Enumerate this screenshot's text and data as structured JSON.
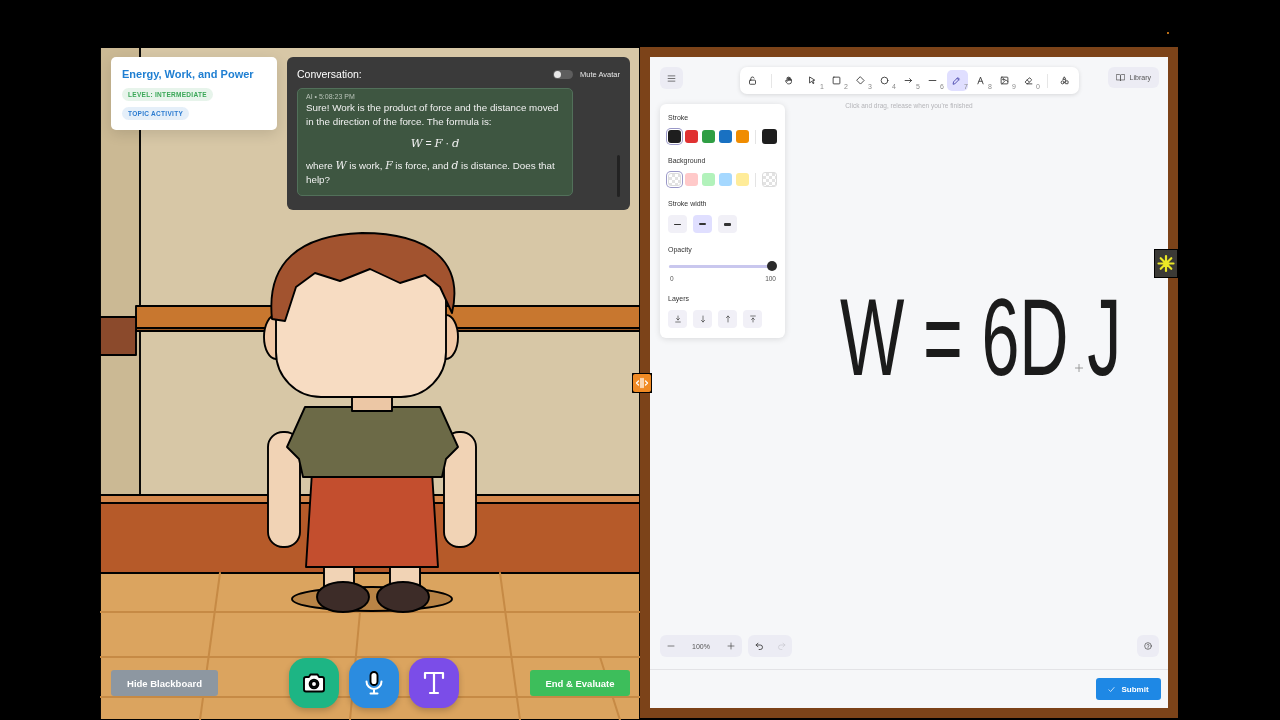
{
  "topic_card": {
    "title": "Energy, Work, and Power",
    "badges": [
      {
        "label": "LEVEL: INTERMEDIATE",
        "color": "#3aa757"
      },
      {
        "label": "TOPIC ACTIVITY",
        "color": "#2b7bd0"
      }
    ]
  },
  "conversation": {
    "title": "Conversation:",
    "mute_toggle": {
      "label": "Mute Avatar",
      "on": false
    },
    "message": {
      "meta": "AI • 5:08:23 PM",
      "paragraphs": [
        {
          "kind": "text",
          "text": "Sure! Work is the product of force and the distance moved in the direction of the force. The formula is:"
        },
        {
          "kind": "formula",
          "text": "*W* = *F* · *d*"
        },
        {
          "kind": "text",
          "text": "where *W* is work, *F* is force, and *d* is distance. Does that help?"
        }
      ]
    }
  },
  "scene_controls": {
    "hide_button": "Hide Blackboard",
    "media_buttons": [
      {
        "kind": "camera"
      },
      {
        "kind": "microphone"
      },
      {
        "kind": "text"
      }
    ],
    "end_button": "End & Evaluate"
  },
  "whiteboard": {
    "toolbar": {
      "tools": [
        {
          "selected": false
        },
        {
          "selected": false
        },
        {
          "shortcut": "1",
          "selected": false
        },
        {
          "shortcut": "2",
          "selected": false
        },
        {
          "shortcut": "3",
          "selected": false
        },
        {
          "shortcut": "4",
          "selected": false
        },
        {
          "shortcut": "5",
          "selected": false
        },
        {
          "shortcut": "6",
          "selected": false
        },
        {
          "shortcut": "7",
          "selected": true
        },
        {
          "shortcut": "8",
          "selected": false
        },
        {
          "shortcut": "9",
          "selected": false
        },
        {
          "shortcut": "0",
          "selected": false
        },
        {
          "selected": false
        }
      ]
    },
    "library_button": "Library",
    "hint": "Click and drag, release when you're finished",
    "properties": {
      "stroke": {
        "label": "Stroke",
        "swatches": [
          {
            "kind": "color",
            "color": "#1e1e1e",
            "selected": true
          },
          {
            "kind": "color",
            "color": "#e03131",
            "selected": false
          },
          {
            "kind": "color",
            "color": "#2f9e44",
            "selected": false
          },
          {
            "kind": "color",
            "color": "#1971c2",
            "selected": false
          },
          {
            "kind": "color",
            "color": "#f08c00",
            "selected": false
          }
        ],
        "current": {
          "kind": "color",
          "color": "#1e1e1e"
        }
      },
      "background": {
        "label": "Background",
        "swatches": [
          {
            "kind": "transparent",
            "selected": true
          },
          {
            "kind": "color",
            "color": "#ffc9c9",
            "selected": false
          },
          {
            "kind": "color",
            "color": "#b2f2bb",
            "selected": false
          },
          {
            "kind": "color",
            "color": "#a5d8ff",
            "selected": false
          },
          {
            "kind": "color",
            "color": "#ffec99",
            "selected": false
          }
        ],
        "current": {
          "kind": "transparent"
        }
      },
      "stroke_width": {
        "label": "Stroke width",
        "options": [
          {
            "selected": false
          },
          {
            "selected": true
          },
          {
            "selected": false
          }
        ]
      },
      "opacity": {
        "label": "Opacity",
        "level": 1,
        "min_label": "0",
        "max_label": "100"
      },
      "layers": {
        "label": "Layers"
      }
    },
    "ink": [
      "W",
      "=",
      "6D",
      "J"
    ],
    "zoom_level": "100%",
    "history": [
      {
        "disabled": false
      },
      {
        "disabled": true
      }
    ],
    "submit_button": "Submit"
  }
}
